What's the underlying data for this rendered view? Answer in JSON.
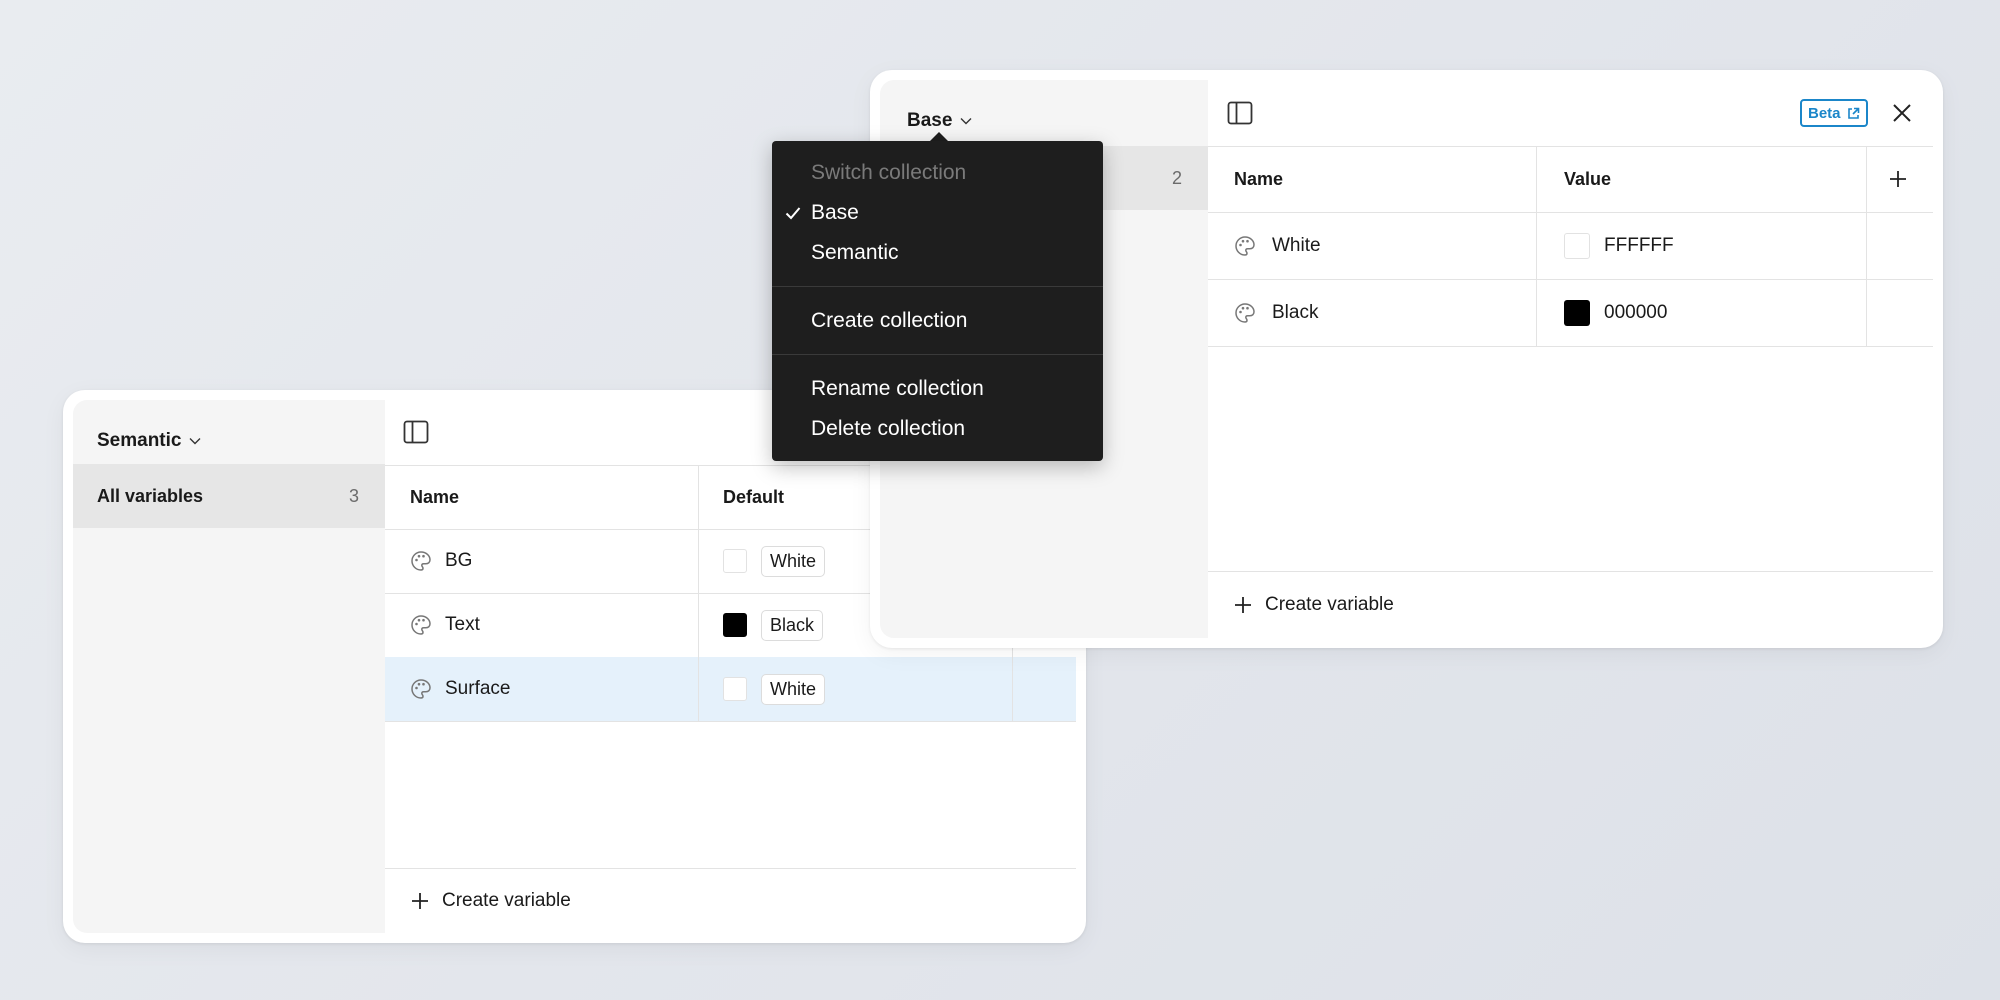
{
  "semantic_panel": {
    "collection_label": "Semantic",
    "sidebar_item": {
      "label": "All variables",
      "count": "3"
    },
    "columns": {
      "name": "Name",
      "default": "Default"
    },
    "rows": [
      {
        "name": "BG",
        "value": "White",
        "swatch": "#FFFFFF"
      },
      {
        "name": "Text",
        "value": "Black",
        "swatch": "#000000"
      },
      {
        "name": "Surface",
        "value": "White",
        "swatch": "#FFFFFF"
      }
    ],
    "selected_row": "Surface",
    "create_variable": "Create variable"
  },
  "base_panel": {
    "collection_label": "Base",
    "sidebar_count": "2",
    "beta_badge": "Beta",
    "columns": {
      "name": "Name",
      "value": "Value"
    },
    "rows": [
      {
        "name": "White",
        "value": "FFFFFF",
        "swatch": "#FFFFFF"
      },
      {
        "name": "Black",
        "value": "000000",
        "swatch": "#000000"
      }
    ],
    "create_variable": "Create variable"
  },
  "collection_menu": {
    "heading": "Switch collection",
    "items": [
      {
        "label": "Base",
        "checked": true
      },
      {
        "label": "Semantic",
        "checked": false
      }
    ],
    "create": "Create collection",
    "rename": "Rename collection",
    "delete": "Delete collection"
  },
  "colors": {
    "selected_row": "#E5F1FB",
    "menu_bg": "#1E1E1E",
    "beta_accent": "#1B86C9",
    "sidebar_bg": "#F5F5F5"
  },
  "icons": [
    "chevron-down-icon",
    "sidebar-toggle-icon",
    "palette-icon",
    "plus-icon",
    "close-icon",
    "external-link-icon",
    "check-icon"
  ]
}
